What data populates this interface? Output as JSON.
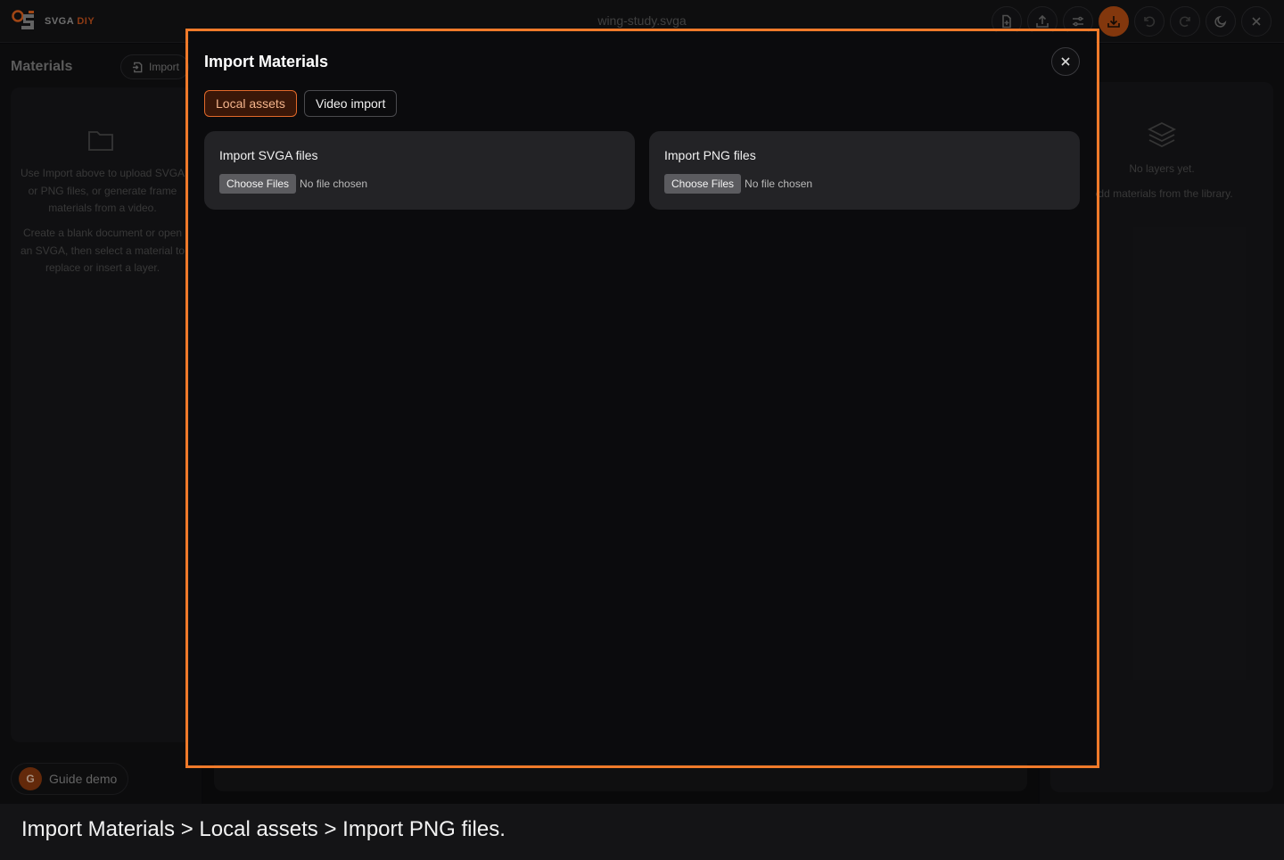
{
  "app": {
    "logo_text_main": "SVGA",
    "logo_text_accent": "DIY",
    "document_title": "wing-study.svga"
  },
  "toolbar": {
    "buttons": [
      {
        "name": "new-document",
        "icon": "file-plus-icon"
      },
      {
        "name": "upload",
        "icon": "upload-icon"
      },
      {
        "name": "settings",
        "icon": "sliders-icon"
      },
      {
        "name": "download",
        "icon": "download-icon"
      },
      {
        "name": "undo",
        "icon": "undo-icon"
      },
      {
        "name": "redo",
        "icon": "redo-icon"
      },
      {
        "name": "theme",
        "icon": "moon-icon"
      },
      {
        "name": "close",
        "icon": "close-icon"
      }
    ]
  },
  "materials": {
    "title": "Materials",
    "import_label": "Import",
    "hint_1": "Use Import above to upload SVGA or PNG files, or generate frame materials from a video.",
    "hint_2": "Create a blank document or open an SVGA, then select a material to replace or insert a layer."
  },
  "layers": {
    "empty_title": "No layers yet.",
    "empty_hint": "Add materials from the library."
  },
  "guide": {
    "avatar_letter": "G",
    "label": "Guide demo"
  },
  "modal": {
    "title": "Import Materials",
    "tabs": [
      {
        "label": "Local assets",
        "active": true
      },
      {
        "label": "Video import",
        "active": false
      }
    ],
    "cards": [
      {
        "label": "Import SVGA files",
        "button": "Choose Files",
        "status": "No file chosen"
      },
      {
        "label": "Import PNG files",
        "button": "Choose Files",
        "status": "No file chosen"
      }
    ]
  },
  "caption": "Import Materials > Local assets > Import PNG files.",
  "colors": {
    "accent": "#f07a2a",
    "primary_button": "#b44d12",
    "background": "#0c0c0e"
  }
}
